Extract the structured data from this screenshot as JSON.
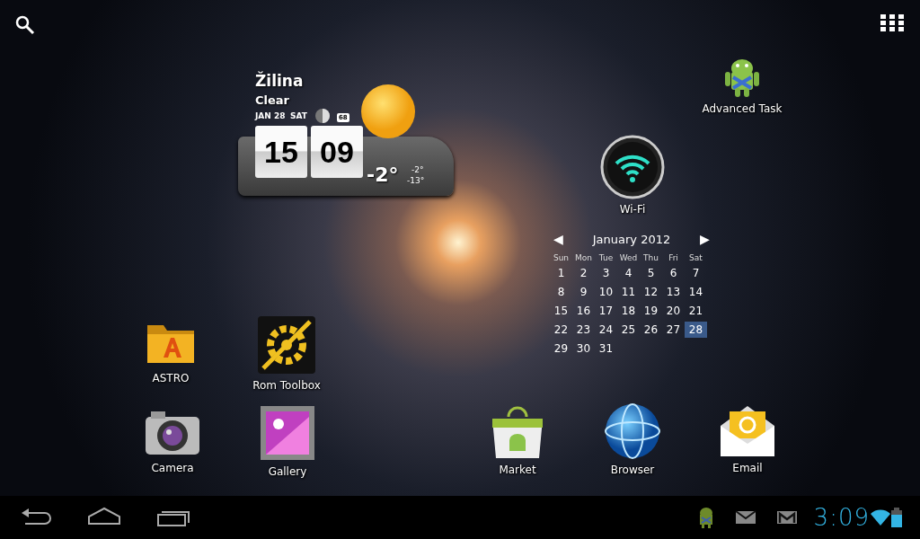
{
  "weather": {
    "city": "Žilina",
    "condition": "Clear",
    "date": "JAN 28",
    "day": "SAT",
    "badge": "68",
    "hours": "15",
    "minutes": "09",
    "temperature": "-2°",
    "high": "-2°",
    "low": "-13°"
  },
  "apps": [
    {
      "label": "Advanced Task",
      "kind": "android"
    },
    {
      "label": "Wi-Fi",
      "kind": "wifi"
    },
    {
      "label": "ASTRO",
      "kind": "folder"
    },
    {
      "label": "Rom Toolbox",
      "kind": "toolbox"
    },
    {
      "label": "Camera",
      "kind": "camera"
    },
    {
      "label": "Gallery",
      "kind": "gallery"
    },
    {
      "label": "Market",
      "kind": "market"
    },
    {
      "label": "Browser",
      "kind": "globe"
    },
    {
      "label": "Email",
      "kind": "email"
    }
  ],
  "calendar": {
    "prev": "◀",
    "month": "January 2012",
    "next": "▶",
    "weekdays": [
      "Sun",
      "Mon",
      "Tue",
      "Wed",
      "Thu",
      "Fri",
      "Sat"
    ],
    "weeks": [
      [
        {
          "day": "1",
          "selected": false
        },
        {
          "day": "2",
          "selected": false
        },
        {
          "day": "3",
          "selected": false
        },
        {
          "day": "4",
          "selected": false
        },
        {
          "day": "5",
          "selected": false
        },
        {
          "day": "6",
          "selected": false
        },
        {
          "day": "7",
          "selected": false
        }
      ],
      [
        {
          "day": "8",
          "selected": false
        },
        {
          "day": "9",
          "selected": false
        },
        {
          "day": "10",
          "selected": false
        },
        {
          "day": "11",
          "selected": false
        },
        {
          "day": "12",
          "selected": false
        },
        {
          "day": "13",
          "selected": false
        },
        {
          "day": "14",
          "selected": false
        }
      ],
      [
        {
          "day": "15",
          "selected": false
        },
        {
          "day": "16",
          "selected": false
        },
        {
          "day": "17",
          "selected": false
        },
        {
          "day": "18",
          "selected": false
        },
        {
          "day": "19",
          "selected": false
        },
        {
          "day": "20",
          "selected": false
        },
        {
          "day": "21",
          "selected": false
        }
      ],
      [
        {
          "day": "22",
          "selected": false
        },
        {
          "day": "23",
          "selected": false
        },
        {
          "day": "24",
          "selected": false
        },
        {
          "day": "25",
          "selected": false
        },
        {
          "day": "26",
          "selected": false
        },
        {
          "day": "27",
          "selected": false
        },
        {
          "day": "28",
          "selected": true
        }
      ],
      [
        {
          "day": "29",
          "selected": false
        },
        {
          "day": "30",
          "selected": false
        },
        {
          "day": "31",
          "selected": false
        }
      ]
    ]
  },
  "status_bar": {
    "time": "3:09"
  }
}
